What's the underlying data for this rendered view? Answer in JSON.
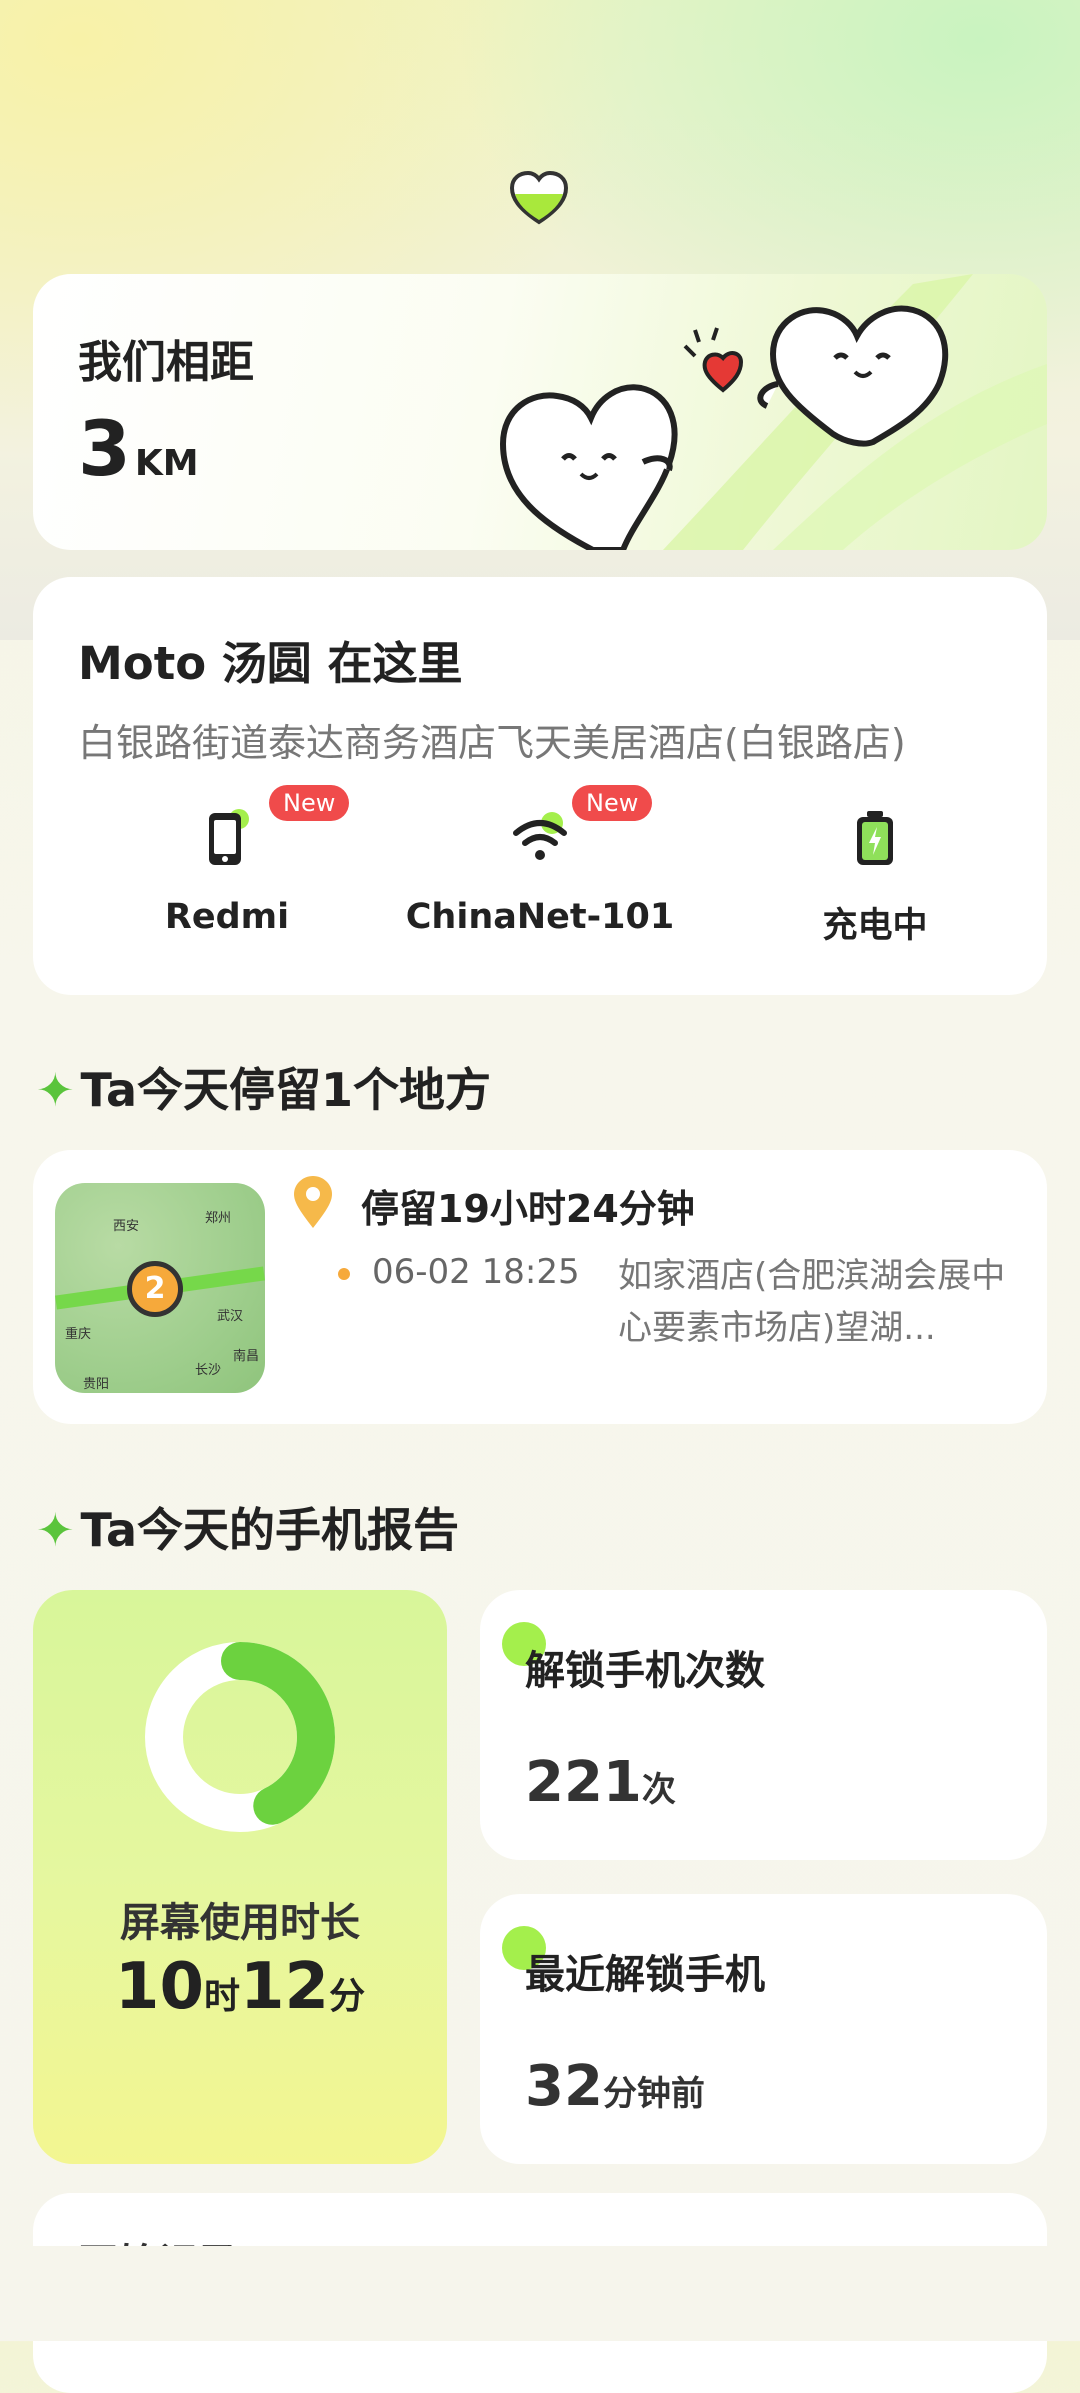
{
  "distance": {
    "title": "我们相距",
    "value": "3",
    "unit": "KM"
  },
  "location": {
    "title": "Moto 汤圆 在这里",
    "address": "白银路街道泰达商务酒店飞天美居酒店(白银路店)",
    "statuses": [
      {
        "label": "Redmi",
        "icon": "phone-icon",
        "badge": "New"
      },
      {
        "label": "ChinaNet-101",
        "icon": "wifi-icon",
        "badge": "New"
      },
      {
        "label": "充电中",
        "icon": "battery-charging-icon",
        "badge": ""
      }
    ]
  },
  "places_section": {
    "title": "Ta今天停留1个地方"
  },
  "stay": {
    "map_count": "2",
    "map_cities": [
      "西安",
      "郑州",
      "重庆",
      "武汉",
      "长沙",
      "南昌",
      "贵阳"
    ],
    "duration": "停留19小时24分钟",
    "time": "06-02 18:25",
    "place": "如家酒店(合肥滨湖会展中心要素市场店)望湖..."
  },
  "report_section": {
    "title": "Ta今天的手机报告"
  },
  "screen_time": {
    "label": "屏幕使用时长",
    "hours": "10",
    "hours_unit": "时",
    "minutes": "12",
    "minutes_unit": "分",
    "ring_fraction": 0.43
  },
  "unlock_count": {
    "label": "解锁手机次数",
    "value": "221",
    "unit": "次"
  },
  "last_unlock": {
    "label": "最近解锁手机",
    "value": "32",
    "unit": "分钟前"
  },
  "bottom_card": {
    "title": "开始记录"
  },
  "colors": {
    "accent_green": "#5ac43c",
    "badge_red": "#f04b4b",
    "pin_orange": "#f6a93b"
  }
}
